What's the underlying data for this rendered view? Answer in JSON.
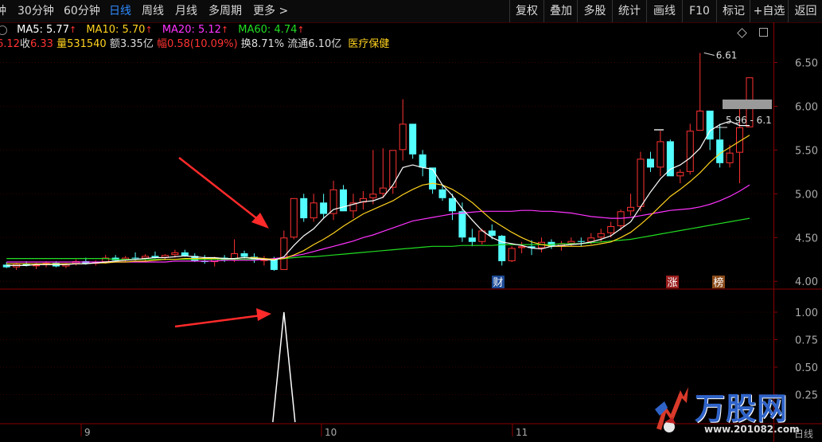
{
  "toolbar": {
    "left": [
      {
        "label": "钟",
        "name": "tab-15min",
        "active": false
      },
      {
        "label": "30分钟",
        "name": "tab-30min",
        "active": false
      },
      {
        "label": "60分钟",
        "name": "tab-60min",
        "active": false
      },
      {
        "label": "日线",
        "name": "tab-daily",
        "active": true
      },
      {
        "label": "周线",
        "name": "tab-weekly",
        "active": false
      },
      {
        "label": "月线",
        "name": "tab-monthly",
        "active": false
      },
      {
        "label": "多周期",
        "name": "tab-multi-period",
        "active": false
      },
      {
        "label": "更多 >",
        "name": "tab-more",
        "active": false
      }
    ],
    "right": [
      "复权",
      "叠加",
      "多股",
      "统计",
      "画线",
      "F10",
      "标记",
      "+自选",
      "返回"
    ]
  },
  "ma_info": {
    "ma5": "MA5: 5.77",
    "ma10": "MA10: 5.70",
    "ma20": "MA20: 5.12",
    "ma60": "MA60: 4.74",
    "colors": {
      "ma5": "#ffffff",
      "ma10": "#ffd21e",
      "ma20": "#ff33ff",
      "ma60": "#22dd22"
    }
  },
  "bar_info": {
    "open": "6.12",
    "close_label": "收",
    "close": "6.33",
    "volume_label": "量",
    "volume": "531540",
    "amount_label": "额",
    "amount": "3.35亿",
    "change_label": "幅",
    "change": "0.58(10.09%)",
    "turnover_label": "换",
    "turnover": "8.71%",
    "float_label": "流通",
    "float": "6.10亿",
    "sector": "医疗保健"
  },
  "chart_data": {
    "type": "candlestick",
    "price_axis": {
      "ticks": [
        "6.50",
        "6.00",
        "5.50",
        "5.00",
        "4.50",
        "4.00"
      ],
      "range": [
        3.92,
        6.65
      ]
    },
    "indicator_axis": {
      "ticks": [
        "1.00",
        "0.75",
        "0.50",
        "0.25"
      ]
    },
    "x_ticks": [
      "9",
      "10",
      "11"
    ],
    "annotations": {
      "high_label": "6.61",
      "range_label": "5.96 - 6.1"
    },
    "event_markers": [
      "财",
      "涨",
      "榜"
    ],
    "bottom_label": "日线",
    "colors": {
      "up": "#ff3232",
      "down": "#54ffff",
      "ma5": "#ffffff",
      "ma10": "#ffd21e",
      "ma20": "#ff33ff",
      "ma60": "#22dd22",
      "signal": "#ffffff",
      "arrow": "#ff2a2a"
    },
    "candles": [
      [
        4.19,
        4.22,
        4.15,
        4.16
      ],
      [
        4.16,
        4.21,
        4.13,
        4.2
      ],
      [
        4.2,
        4.23,
        4.17,
        4.18
      ],
      [
        4.18,
        4.21,
        4.14,
        4.19
      ],
      [
        4.19,
        4.23,
        4.16,
        4.21
      ],
      [
        4.21,
        4.23,
        4.16,
        4.17
      ],
      [
        4.17,
        4.21,
        4.15,
        4.2
      ],
      [
        4.2,
        4.25,
        4.18,
        4.23
      ],
      [
        4.23,
        4.27,
        4.19,
        4.2
      ],
      [
        4.2,
        4.24,
        4.18,
        4.22
      ],
      [
        4.22,
        4.3,
        4.2,
        4.27
      ],
      [
        4.27,
        4.3,
        4.22,
        4.24
      ],
      [
        4.24,
        4.29,
        4.22,
        4.27
      ],
      [
        4.27,
        4.33,
        4.24,
        4.26
      ],
      [
        4.26,
        4.31,
        4.22,
        4.29
      ],
      [
        4.29,
        4.34,
        4.26,
        4.27
      ],
      [
        4.27,
        4.31,
        4.24,
        4.3
      ],
      [
        4.3,
        4.36,
        4.27,
        4.33
      ],
      [
        4.33,
        4.36,
        4.28,
        4.29
      ],
      [
        4.29,
        4.32,
        4.22,
        4.23
      ],
      [
        4.23,
        4.3,
        4.2,
        4.22
      ],
      [
        4.22,
        4.28,
        4.17,
        4.27
      ],
      [
        4.27,
        4.3,
        4.22,
        4.24
      ],
      [
        4.24,
        4.48,
        4.22,
        4.32
      ],
      [
        4.32,
        4.35,
        4.26,
        4.28
      ],
      [
        4.28,
        4.32,
        4.21,
        4.24
      ],
      [
        4.24,
        4.29,
        4.18,
        4.25
      ],
      [
        4.25,
        4.28,
        4.12,
        4.13
      ],
      [
        4.13,
        4.58,
        4.13,
        4.5
      ],
      [
        4.5,
        4.95,
        4.48,
        4.95
      ],
      [
        4.95,
        5.0,
        4.68,
        4.72
      ],
      [
        4.72,
        5.0,
        4.68,
        4.9
      ],
      [
        4.9,
        5.0,
        4.72,
        4.77
      ],
      [
        4.77,
        5.15,
        4.7,
        5.05
      ],
      [
        5.05,
        5.1,
        4.8,
        4.8
      ],
      [
        4.8,
        5.0,
        4.72,
        4.9
      ],
      [
        4.9,
        5.03,
        4.82,
        4.95
      ],
      [
        4.95,
        5.5,
        4.88,
        5.0
      ],
      [
        5.0,
        5.52,
        4.95,
        5.07
      ],
      [
        5.07,
        5.5,
        5.0,
        5.5
      ],
      [
        5.5,
        6.08,
        5.38,
        5.8
      ],
      [
        5.8,
        5.8,
        5.4,
        5.45
      ],
      [
        5.45,
        5.5,
        5.2,
        5.3
      ],
      [
        5.3,
        5.3,
        5.0,
        5.05
      ],
      [
        5.05,
        5.1,
        4.92,
        4.95
      ],
      [
        4.95,
        5.0,
        4.7,
        4.8
      ],
      [
        4.8,
        4.9,
        4.45,
        4.5
      ],
      [
        4.5,
        4.6,
        4.4,
        4.45
      ],
      [
        4.45,
        4.6,
        4.42,
        4.58
      ],
      [
        4.58,
        4.65,
        4.48,
        4.52
      ],
      [
        4.52,
        4.53,
        4.18,
        4.23
      ],
      [
        4.23,
        4.4,
        4.22,
        4.38
      ],
      [
        4.38,
        4.45,
        4.32,
        4.4
      ],
      [
        4.4,
        4.47,
        4.3,
        4.38
      ],
      [
        4.38,
        4.5,
        4.33,
        4.45
      ],
      [
        4.45,
        4.48,
        4.37,
        4.4
      ],
      [
        4.4,
        4.46,
        4.35,
        4.43
      ],
      [
        4.43,
        4.5,
        4.4,
        4.46
      ],
      [
        4.46,
        4.5,
        4.4,
        4.45
      ],
      [
        4.45,
        4.55,
        4.42,
        4.5
      ],
      [
        4.5,
        4.6,
        4.45,
        4.55
      ],
      [
        4.55,
        4.68,
        4.5,
        4.63
      ],
      [
        4.63,
        4.82,
        4.58,
        4.8
      ],
      [
        4.8,
        5.0,
        4.75,
        4.85
      ],
      [
        4.85,
        5.48,
        4.8,
        5.4
      ],
      [
        5.4,
        5.48,
        5.25,
        5.3
      ],
      [
        5.3,
        5.72,
        5.2,
        5.6
      ],
      [
        5.6,
        5.62,
        5.2,
        5.2
      ],
      [
        5.2,
        5.28,
        5.12,
        5.25
      ],
      [
        5.25,
        5.8,
        5.22,
        5.72
      ],
      [
        5.72,
        6.61,
        5.72,
        5.95
      ],
      [
        5.95,
        5.95,
        5.5,
        5.62
      ],
      [
        5.62,
        5.8,
        5.3,
        5.35
      ],
      [
        5.35,
        5.56,
        5.3,
        5.47
      ],
      [
        5.47,
        6.0,
        5.12,
        5.76
      ],
      [
        5.76,
        6.33,
        5.76,
        6.33
      ]
    ],
    "ma5": [
      4.18,
      4.18,
      4.18,
      4.19,
      4.19,
      4.19,
      4.19,
      4.2,
      4.2,
      4.21,
      4.22,
      4.23,
      4.24,
      4.25,
      4.26,
      4.27,
      4.27,
      4.28,
      4.29,
      4.28,
      4.27,
      4.27,
      4.26,
      4.26,
      4.27,
      4.26,
      4.25,
      4.24,
      4.28,
      4.41,
      4.52,
      4.6,
      4.72,
      4.82,
      4.85,
      4.88,
      4.91,
      4.92,
      4.96,
      5.1,
      5.3,
      5.33,
      5.3,
      5.28,
      5.1,
      4.98,
      4.83,
      4.7,
      4.58,
      4.5,
      4.45,
      4.43,
      4.41,
      4.38,
      4.37,
      4.4,
      4.41,
      4.42,
      4.43,
      4.45,
      4.48,
      4.52,
      4.6,
      4.68,
      4.85,
      5.02,
      5.17,
      5.28,
      5.33,
      5.41,
      5.52,
      5.72,
      5.79,
      5.83,
      5.78,
      5.78
    ],
    "ma10": [
      4.2,
      4.2,
      4.2,
      4.2,
      4.2,
      4.2,
      4.2,
      4.2,
      4.2,
      4.21,
      4.21,
      4.22,
      4.22,
      4.23,
      4.23,
      4.24,
      4.25,
      4.25,
      4.26,
      4.26,
      4.26,
      4.26,
      4.26,
      4.26,
      4.27,
      4.27,
      4.26,
      4.25,
      4.26,
      4.3,
      4.35,
      4.42,
      4.48,
      4.55,
      4.63,
      4.7,
      4.77,
      4.82,
      4.87,
      4.92,
      4.99,
      5.05,
      5.1,
      5.12,
      5.1,
      5.05,
      4.98,
      4.9,
      4.8,
      4.7,
      4.63,
      4.56,
      4.5,
      4.45,
      4.42,
      4.4,
      4.4,
      4.4,
      4.4,
      4.41,
      4.43,
      4.45,
      4.5,
      4.56,
      4.65,
      4.75,
      4.86,
      4.97,
      5.05,
      5.14,
      5.24,
      5.36,
      5.46,
      5.53,
      5.6,
      5.67
    ],
    "ma20": [
      4.22,
      4.22,
      4.22,
      4.22,
      4.22,
      4.22,
      4.22,
      4.22,
      4.22,
      4.22,
      4.22,
      4.22,
      4.22,
      4.22,
      4.22,
      4.22,
      4.22,
      4.23,
      4.23,
      4.23,
      4.23,
      4.23,
      4.24,
      4.24,
      4.24,
      4.24,
      4.25,
      4.26,
      4.27,
      4.29,
      4.31,
      4.34,
      4.37,
      4.4,
      4.43,
      4.46,
      4.5,
      4.53,
      4.57,
      4.61,
      4.65,
      4.69,
      4.71,
      4.73,
      4.75,
      4.77,
      4.78,
      4.79,
      4.8,
      4.8,
      4.8,
      4.8,
      4.81,
      4.81,
      4.8,
      4.8,
      4.79,
      4.78,
      4.76,
      4.74,
      4.73,
      4.72,
      4.72,
      4.73,
      4.75,
      4.77,
      4.79,
      4.81,
      4.82,
      4.83,
      4.85,
      4.88,
      4.92,
      4.97,
      5.03,
      5.1
    ],
    "ma60": [
      4.26,
      4.26,
      4.26,
      4.26,
      4.26,
      4.26,
      4.26,
      4.26,
      4.26,
      4.26,
      4.26,
      4.25,
      4.25,
      4.25,
      4.25,
      4.25,
      4.25,
      4.25,
      4.25,
      4.25,
      4.25,
      4.25,
      4.25,
      4.25,
      4.25,
      4.25,
      4.25,
      4.25,
      4.26,
      4.27,
      4.28,
      4.28,
      4.29,
      4.3,
      4.31,
      4.32,
      4.33,
      4.34,
      4.35,
      4.36,
      4.37,
      4.38,
      4.39,
      4.4,
      4.4,
      4.4,
      4.41,
      4.41,
      4.41,
      4.41,
      4.42,
      4.42,
      4.42,
      4.42,
      4.42,
      4.42,
      4.43,
      4.43,
      4.43,
      4.44,
      4.45,
      4.46,
      4.47,
      4.48,
      4.5,
      4.52,
      4.54,
      4.56,
      4.58,
      4.6,
      4.62,
      4.64,
      4.66,
      4.68,
      4.7,
      4.72
    ],
    "signal": [
      0,
      0,
      0,
      0,
      0,
      0,
      0,
      0,
      0,
      0,
      0,
      0,
      0,
      0,
      0,
      0,
      0,
      0,
      0,
      0,
      0,
      0,
      0,
      0,
      0,
      0,
      0,
      0,
      1,
      0,
      0,
      0,
      0,
      0,
      0,
      0,
      0,
      0,
      0,
      0,
      0,
      0,
      0,
      0,
      0,
      0,
      0,
      0,
      0,
      0,
      0,
      0,
      0,
      0,
      0,
      0,
      0,
      0,
      0,
      0,
      0,
      0,
      0,
      0,
      0,
      0,
      0,
      0,
      0,
      0,
      0,
      0,
      0,
      0,
      0,
      0
    ],
    "signal_range": [
      0,
      1
    ]
  },
  "watermark": {
    "brand": "万股网",
    "url": "www.201082.com"
  }
}
